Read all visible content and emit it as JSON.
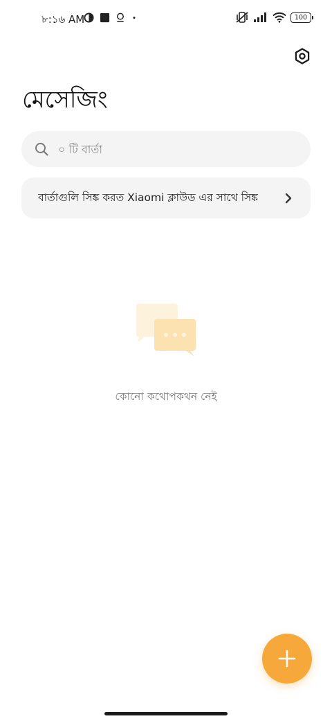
{
  "status_bar": {
    "time": "৮:১৬ AM",
    "battery": "100"
  },
  "header": {
    "title": "মেসেজিং"
  },
  "search": {
    "placeholder": "০ টি বার্তা"
  },
  "sync_banner": {
    "text": "বার্তাগুলি সিঙ্ক করত Xiaomi ক্লাউড এর সাথে সিঙ্ক"
  },
  "empty_state": {
    "text": "কোনো কথোপকথন নেই"
  },
  "icons": {
    "settings": "hexagon-settings-icon",
    "search": "search-icon",
    "chevron": "chevron-right-icon",
    "add": "plus-icon"
  },
  "colors": {
    "accent": "#f7a83b",
    "surface": "#f4f4f4",
    "illustration_light": "#fdf3dd",
    "illustration_main": "#fbe2b0"
  }
}
